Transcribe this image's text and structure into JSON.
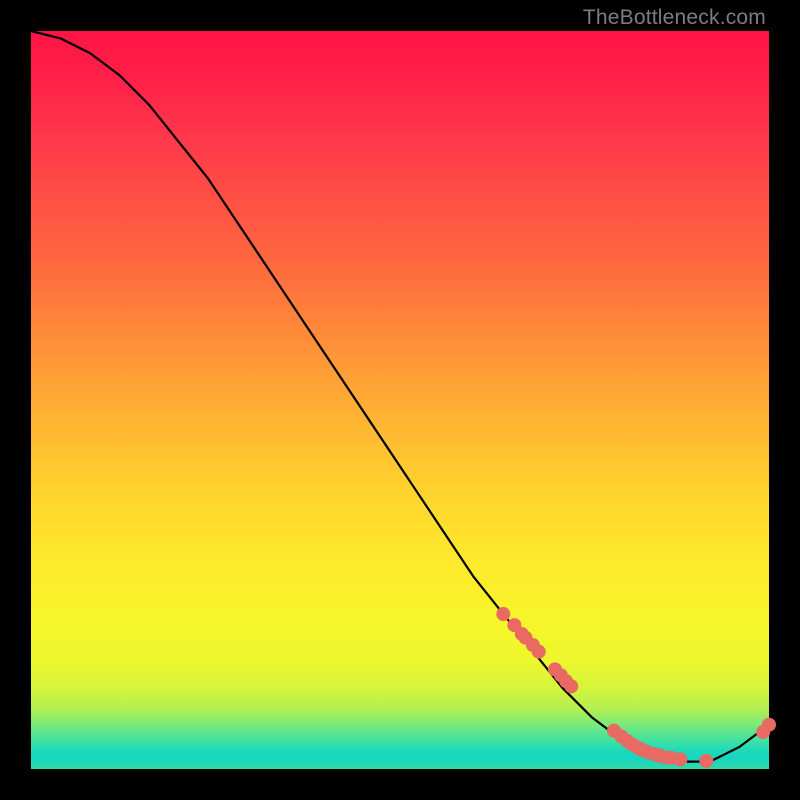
{
  "watermark": "TheBottleneck.com",
  "chart_data": {
    "type": "line",
    "title": "",
    "xlabel": "",
    "ylabel": "",
    "xlim": [
      0,
      100
    ],
    "ylim": [
      0,
      100
    ],
    "series": [
      {
        "name": "curve",
        "x": [
          0,
          4,
          8,
          12,
          16,
          20,
          24,
          28,
          32,
          36,
          40,
          44,
          48,
          52,
          56,
          60,
          64,
          68,
          72,
          76,
          80,
          84,
          88,
          92,
          96,
          100
        ],
        "y": [
          100,
          99,
          97,
          94,
          90,
          85,
          80,
          74,
          68,
          62,
          56,
          50,
          44,
          38,
          32,
          26,
          21,
          16,
          11,
          7,
          4,
          2,
          1,
          1,
          3,
          6
        ]
      }
    ],
    "markers": {
      "name": "points",
      "x": [
        64.0,
        65.5,
        66.5,
        67.0,
        68.0,
        68.8,
        71.0,
        71.8,
        72.5,
        73.2,
        79.0,
        80.0,
        80.8,
        81.5,
        82.2,
        82.8,
        83.5,
        84.5,
        85.2,
        86.0,
        86.8,
        88.0,
        91.5,
        99.2,
        100.0
      ],
      "y": [
        21.0,
        19.5,
        18.3,
        17.8,
        16.8,
        15.9,
        13.5,
        12.7,
        11.9,
        11.2,
        5.2,
        4.4,
        3.8,
        3.3,
        2.9,
        2.6,
        2.3,
        2.0,
        1.8,
        1.6,
        1.5,
        1.3,
        1.1,
        5.0,
        6.0
      ]
    },
    "colors": {
      "line": "#000000",
      "marker_fill": "#e86a62",
      "marker_stroke": "#b84d47"
    }
  }
}
